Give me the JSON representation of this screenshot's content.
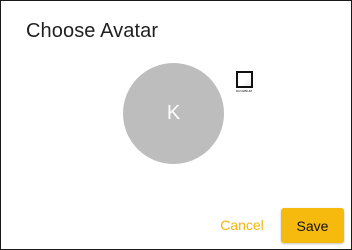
{
  "dialog": {
    "title": "Choose Avatar"
  },
  "avatar": {
    "initial": "K",
    "background_color": "#bdbdbd"
  },
  "logo": {
    "text": "DUCEBIUM"
  },
  "actions": {
    "cancel_label": "Cancel",
    "save_label": "Save",
    "accent_color": "#f6b90d"
  }
}
